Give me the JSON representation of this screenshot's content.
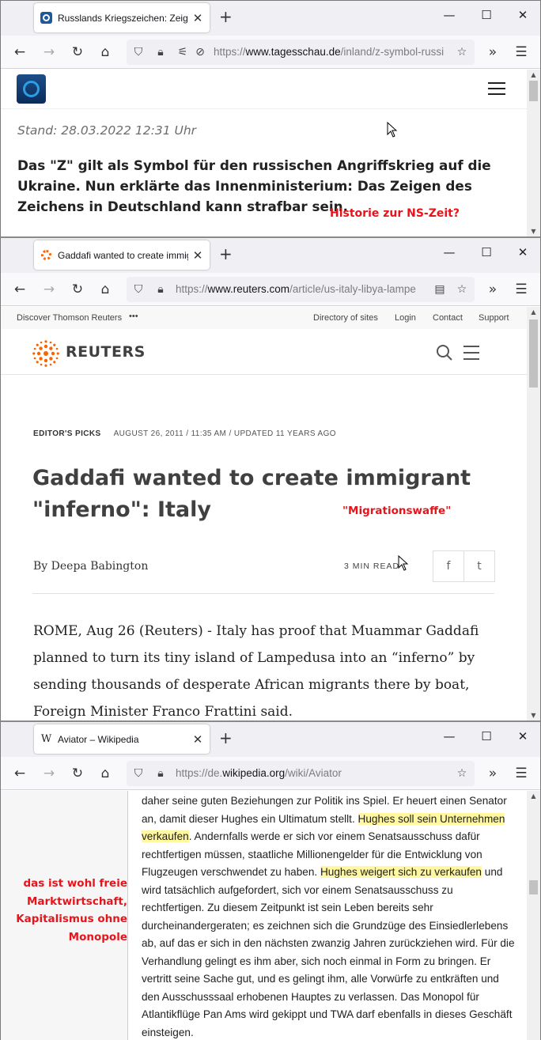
{
  "window1": {
    "tab_title": "Russlands Kriegszeichen: Zeigen",
    "url_domain": "www.tagesschau.de",
    "url_prefix": "https://",
    "url_path": "/inland/z-symbol-russi",
    "stand": "Stand: 28.03.2022 12:31 Uhr",
    "teaser": "Das \"Z\" gilt als Symbol für den russischen Angriffskrieg auf die Ukraine. Nun erklärte das Innenministerium: Das Zeigen des Zeichens in Deutschland kann strafbar sein.",
    "annotation": "Historie zur NS-Zeit?"
  },
  "window2": {
    "tab_title": "Gaddafi wanted to create immig",
    "url_prefix": "https://",
    "url_domain": "www.reuters.com",
    "url_path": "/article/us-italy-libya-lampe",
    "topbar": {
      "discover": "Discover Thomson Reuters",
      "more": "•••",
      "directory": "Directory of sites",
      "login": "Login",
      "contact": "Contact",
      "support": "Support"
    },
    "logo_text": "REUTERS",
    "editors_picks": "EDITOR'S PICKS",
    "dateline": "AUGUST 26, 2011 / 11:35 AM / UPDATED 11 YEARS AGO",
    "headline": "Gaddafi wanted to create immigrant \"inferno\": Italy",
    "byline_prefix": "By",
    "author": "Deepa Babington",
    "read_time": "3 MIN READ",
    "share_facebook": "f",
    "share_twitter": "t",
    "body": "ROME, Aug 26 (Reuters) - Italy has proof that Muammar Gaddafi planned to turn its tiny island of Lampedusa into an “inferno” by sending thousands of desperate African migrants there by boat, Foreign Minister Franco Frattini said.",
    "annotation": "\"Migrationswaffe\""
  },
  "window3": {
    "tab_title": "Aviator – Wikipedia",
    "url_prefix": "https://de.",
    "url_domain": "wikipedia.org",
    "url_path": "/wiki/Aviator",
    "p1": "daher seine guten Beziehungen zur Politik ins Spiel. Er heuert einen Senator an, damit dieser Hughes ein Ultimatum stellt. ",
    "hl1": "Hughes soll sein Unternehmen verkaufen",
    "p2": ". Andernfalls werde er sich vor einem Senatsausschuss dafür rechtfertigen müssen, staatliche Millionengelder für die Entwicklung von Flugzeugen verschwendet zu haben. ",
    "hl2": "Hughes weigert sich zu verkaufen",
    "p3": " und wird tatsächlich aufgefordert, sich vor einem Senatsausschuss zu rechtfertigen. Zu diesem Zeitpunkt ist sein Leben bereits sehr durcheinandergeraten; es zeichnen sich die Grundzüge des Einsiedlerlebens ab, auf das er sich in den nächsten zwanzig Jahren zurückziehen wird. Für die Verhandlung gelingt es ihm aber, sich noch einmal in Form zu bringen. Er vertritt seine Sache gut, und es gelingt ihm, alle Vorwürfe zu entkräften und den Ausschusssaal erhobenen Hauptes zu verlassen. Das Monopol für Atlantikflüge Pan Ams wird gekippt und TWA darf ebenfalls in dieses Geschäft einsteigen.",
    "annotation_lines": [
      "das ist wohl freie",
      "Marktwirtschaft,",
      "Kapitalismus ohne",
      "Monopole"
    ]
  },
  "colors": {
    "annotation": "#e8141c",
    "highlight": "#fff8a0",
    "reuters_orange": "#fa6400"
  }
}
